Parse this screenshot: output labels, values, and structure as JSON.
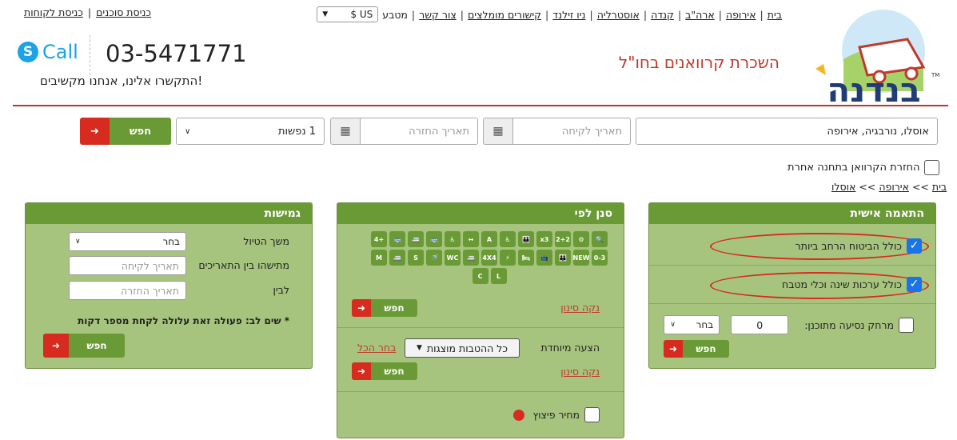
{
  "topnav": {
    "items": [
      "בית",
      "אירופה",
      "ארה\"ב",
      "קנדה",
      "אוסטרליה",
      "ניו זילנד",
      "קישורים מומלצים",
      "צור קשר"
    ],
    "currency_label": "מטבע",
    "currency_value": "US $"
  },
  "toplinks": {
    "agents": "כניסת סוכנים",
    "customers": "כניסת לקוחות"
  },
  "brand": {
    "name": "בנדנה",
    "tagline": "השכרת קרוואנים בחו\"ל",
    "accent": "#c0392b"
  },
  "contact": {
    "phone": "03-5471771",
    "skype": "Call",
    "listen": "התקשרו אלינו, אנחנו מקשיבים!"
  },
  "search": {
    "destination": "אוסלו, נורבגיה, אירופה",
    "pickup_placeholder": "תאריך לקיחה",
    "return_placeholder": "תאריך החזרה",
    "passengers": "1 נפשות",
    "button": "חפש",
    "other_station": "החזרת הקרוואן בתחנה אחרת"
  },
  "breadcrumb": {
    "home": "בית",
    "sep1": ">>",
    "europe": "אירופה",
    "sep2": ">>",
    "current": "אוסלו"
  },
  "personal": {
    "title": "התאמה אישית",
    "opt1": "כולל הביטוח הרחב ביותר",
    "opt2": "כולל ערכות שינה וכלי מטבח",
    "distance_label": "מרחק נסיעה מתוכנן:",
    "distance_value": "0",
    "distance_unit": "בחר",
    "search": "חפש"
  },
  "filter": {
    "title": "סנן לפי",
    "icons": [
      "🔍",
      "⚙",
      "2+2",
      "x3",
      "👪",
      "♿",
      "A",
      "↔",
      "♿",
      "🚌",
      "🚐",
      "🚌",
      "+4",
      "0-3",
      "NEW",
      "👪",
      "📺",
      "🛏",
      "⚡",
      "4X4",
      "🚐",
      "WC",
      "🚿",
      "S",
      "🚐",
      "M",
      "L",
      "C"
    ],
    "clear": "נקה סינון",
    "search": "חפש",
    "special_label": "הצעה מיוחדת",
    "special_value": "כל ההטבות מוצגות",
    "select_all": "בחר הכל",
    "clear2": "נקה סינון",
    "search2": "חפש",
    "compensation": "מחיר פיצוץ"
  },
  "flex": {
    "title": "גמישות",
    "duration_label": "משך הטיול",
    "duration_value": "בחר",
    "between_label": "מתישהו בין התאריכים",
    "between_placeholder": "תאריך לקיחה",
    "to_label": "לבין",
    "to_placeholder": "תאריך החזרה",
    "note": "* שים לב: פעולה זאת עלולה לקחת מספר דקות",
    "search": "חפש"
  }
}
